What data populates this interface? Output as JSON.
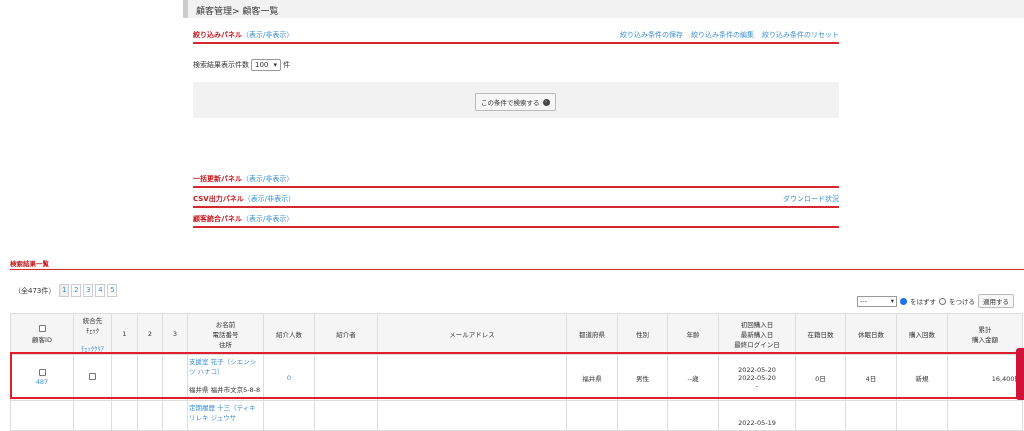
{
  "breadcrumb": "顧客管理> 顧客一覧",
  "filter_panel": {
    "title": "絞り込みパネル",
    "toggle": "（表示/非表示）",
    "links": [
      "絞り込み条件の保存",
      "絞り込み条件の編集",
      "絞り込み条件のリセット"
    ]
  },
  "per_page": {
    "label": "検索結果表示件数",
    "value": "100",
    "unit": "件"
  },
  "search_button": "この条件で検索する",
  "bulk_panel": {
    "title": "一括更新パネル",
    "toggle": "（表示/非表示）"
  },
  "csv_panel": {
    "title": "CSV出力パネル",
    "toggle": "（表示/非表示）",
    "link": "ダウンロード状況"
  },
  "merge_panel": {
    "title": "顧客統合パネル",
    "toggle": "（表示/非表示）"
  },
  "results": {
    "title": "検索結果一覧",
    "total": "（全473件）",
    "pages": [
      "1",
      "2",
      "3",
      "4",
      "5"
    ],
    "bulk_select": "---",
    "radio_remove": "をはずす",
    "radio_add": "をつける",
    "apply": "適用する"
  },
  "table": {
    "headers": {
      "id": "顧客ID",
      "merge": "統合先",
      "merge_check": "ﾁｪｯｸ",
      "merge_clear": "ﾁｪｯｸｸﾘｱ",
      "c1": "1",
      "c2": "2",
      "c3": "3",
      "name1": "お名前",
      "name2": "電話番号",
      "name3": "住所",
      "referrals": "紹介人数",
      "referrer": "紹介者",
      "email": "メールアドレス",
      "pref": "都道府県",
      "gender": "性別",
      "age": "年齢",
      "date1": "初回購入日",
      "date2": "最新購入日",
      "date3": "最終ログイン日",
      "days_member": "在籍日数",
      "days_idle": "休眠日数",
      "purchases": "購入回数",
      "total1": "累計",
      "total2": "購入金額"
    },
    "rows": [
      {
        "id": "487",
        "name": "支援室 花子（シエンシツ ハナコ）",
        "address": "福井県 福井市文京5-8-8",
        "referrals": "0",
        "pref": "福井県",
        "gender": "男性",
        "age": "--歳",
        "first": "2022-05-20",
        "latest": "2022-05-20",
        "login": "-",
        "days_member": "0日",
        "days_idle": "4日",
        "purchases": "新規",
        "total": "16,400円"
      },
      {
        "name": "定期履歴 十三（ティキリレキ ジュウサ",
        "first": "2022-05-19"
      }
    ]
  }
}
